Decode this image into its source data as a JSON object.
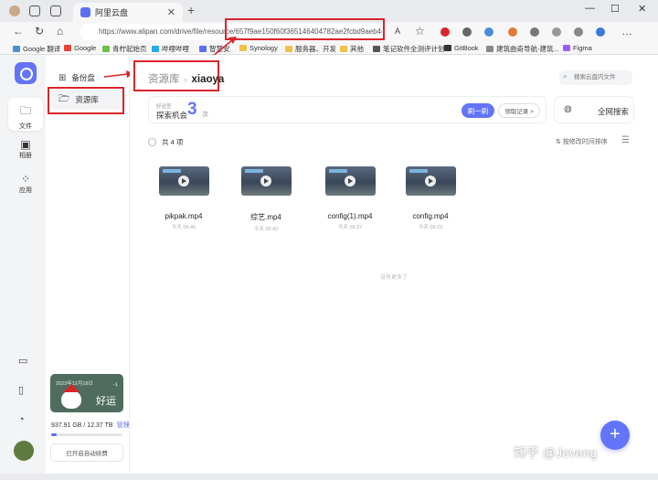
{
  "browser": {
    "tab_title": "阿里云盘",
    "url": "https://www.alipan.com/drive/file/resource/657f9ae150f60f365146404782ae2fcbd9aeb4e2",
    "bookmarks": [
      "Google 翻译",
      "Google",
      "青柠起始页",
      "哔哩哔哩",
      "智慧安",
      "Synology",
      "服务器、开发",
      "其他",
      "笔记软件全测评计划",
      "GitBook",
      "建筑曲奇导航-建筑...",
      "Figma"
    ]
  },
  "rail": {
    "items": [
      {
        "label": "文件",
        "icon": "folder-icon"
      },
      {
        "label": "相册",
        "icon": "photo-icon"
      },
      {
        "label": "应用",
        "icon": "apps-icon"
      }
    ]
  },
  "sidebar": {
    "items": [
      {
        "label": "备份盘",
        "icon": "backup-disk-icon"
      },
      {
        "label": "资源库",
        "icon": "resource-folder-icon"
      }
    ],
    "promo": {
      "date": "2023年12月18日",
      "word": "好运",
      "mark": "-1"
    },
    "storage": {
      "text": "937.91 GB / 12.37 TB",
      "manage": "管理",
      "fraction": 0.074
    },
    "auto_label": "已开启自动续费"
  },
  "main": {
    "breadcrumb": {
      "parent": "资源库",
      "current": "xiaoya"
    },
    "search_placeholder": "搜索云盘内文件",
    "explore": {
      "subtitle": "好运签",
      "title": "探索机会",
      "count": "3",
      "unit": "次",
      "shuffle": "刷一刷",
      "claim": "领取记录 >"
    },
    "websearch": "全网搜索",
    "count_text": "共 4 项",
    "sort_text": "按修改时间排序",
    "files": [
      {
        "name": "pikpak.mp4",
        "date": "今天 09:46"
      },
      {
        "name": "综艺.mp4",
        "date": "今天 09:42"
      },
      {
        "name": "config(1).mp4",
        "date": "今天 09:37"
      },
      {
        "name": "config.mp4",
        "date": "今天 09:23"
      }
    ],
    "no_more": "没有更多了"
  },
  "watermark": "知乎 @Joveng",
  "colors": {
    "accent": "#6374f8",
    "highlight": "#d9242b"
  }
}
